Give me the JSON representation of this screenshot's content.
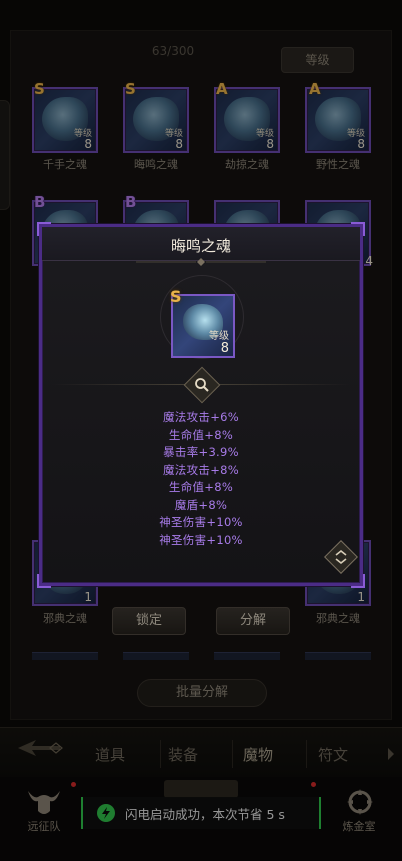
{
  "inventory": {
    "count": "63/300",
    "sort_label": "等级",
    "level_label": "等级",
    "items": [
      {
        "grade": "S",
        "name": "千手之魂",
        "level": "8"
      },
      {
        "grade": "S",
        "name": "晦鸣之魂",
        "level": "8"
      },
      {
        "grade": "A",
        "name": "劫掠之魂",
        "level": "8"
      },
      {
        "grade": "A",
        "name": "野性之魂",
        "level": "8"
      },
      {
        "grade": "B",
        "name": "",
        "level": ""
      },
      {
        "grade": "B",
        "name": "",
        "level": ""
      },
      {
        "grade": "",
        "name": "",
        "level": ""
      },
      {
        "grade": "",
        "name": "",
        "level": "4"
      }
    ],
    "bottom_items": [
      {
        "name": "邪典之魂",
        "level": "1"
      },
      {
        "name": "邪典之魂",
        "level": "1"
      }
    ],
    "lock_label": "锁定",
    "decompose_label": "分解",
    "batch_label": "批量分解"
  },
  "tabs": [
    {
      "label": "道具"
    },
    {
      "label": "装备"
    },
    {
      "label": "魔物"
    },
    {
      "label": "符文"
    }
  ],
  "bottom_nav": [
    {
      "label": "远征队"
    },
    {
      "label": "炼金室"
    }
  ],
  "toast": {
    "icon": "bolt-icon",
    "text": "闪电启动成功，本次节省 5 s"
  },
  "modal": {
    "title": "晦鸣之魂",
    "grade": "S",
    "level_label": "等级",
    "level": "8",
    "stats": [
      "魔法攻击+6%",
      "生命值+8%",
      "暴击率+3.9%",
      "魔法攻击+8%",
      "生命值+8%",
      "魔盾+8%",
      "神圣伤害+10%",
      "神圣伤害+10%"
    ]
  },
  "colors": {
    "accent_purple": "#4b2c86",
    "stat_text": "#a77be8",
    "grade_gold": "#e8b24a",
    "toast_green": "#2fc44a"
  }
}
